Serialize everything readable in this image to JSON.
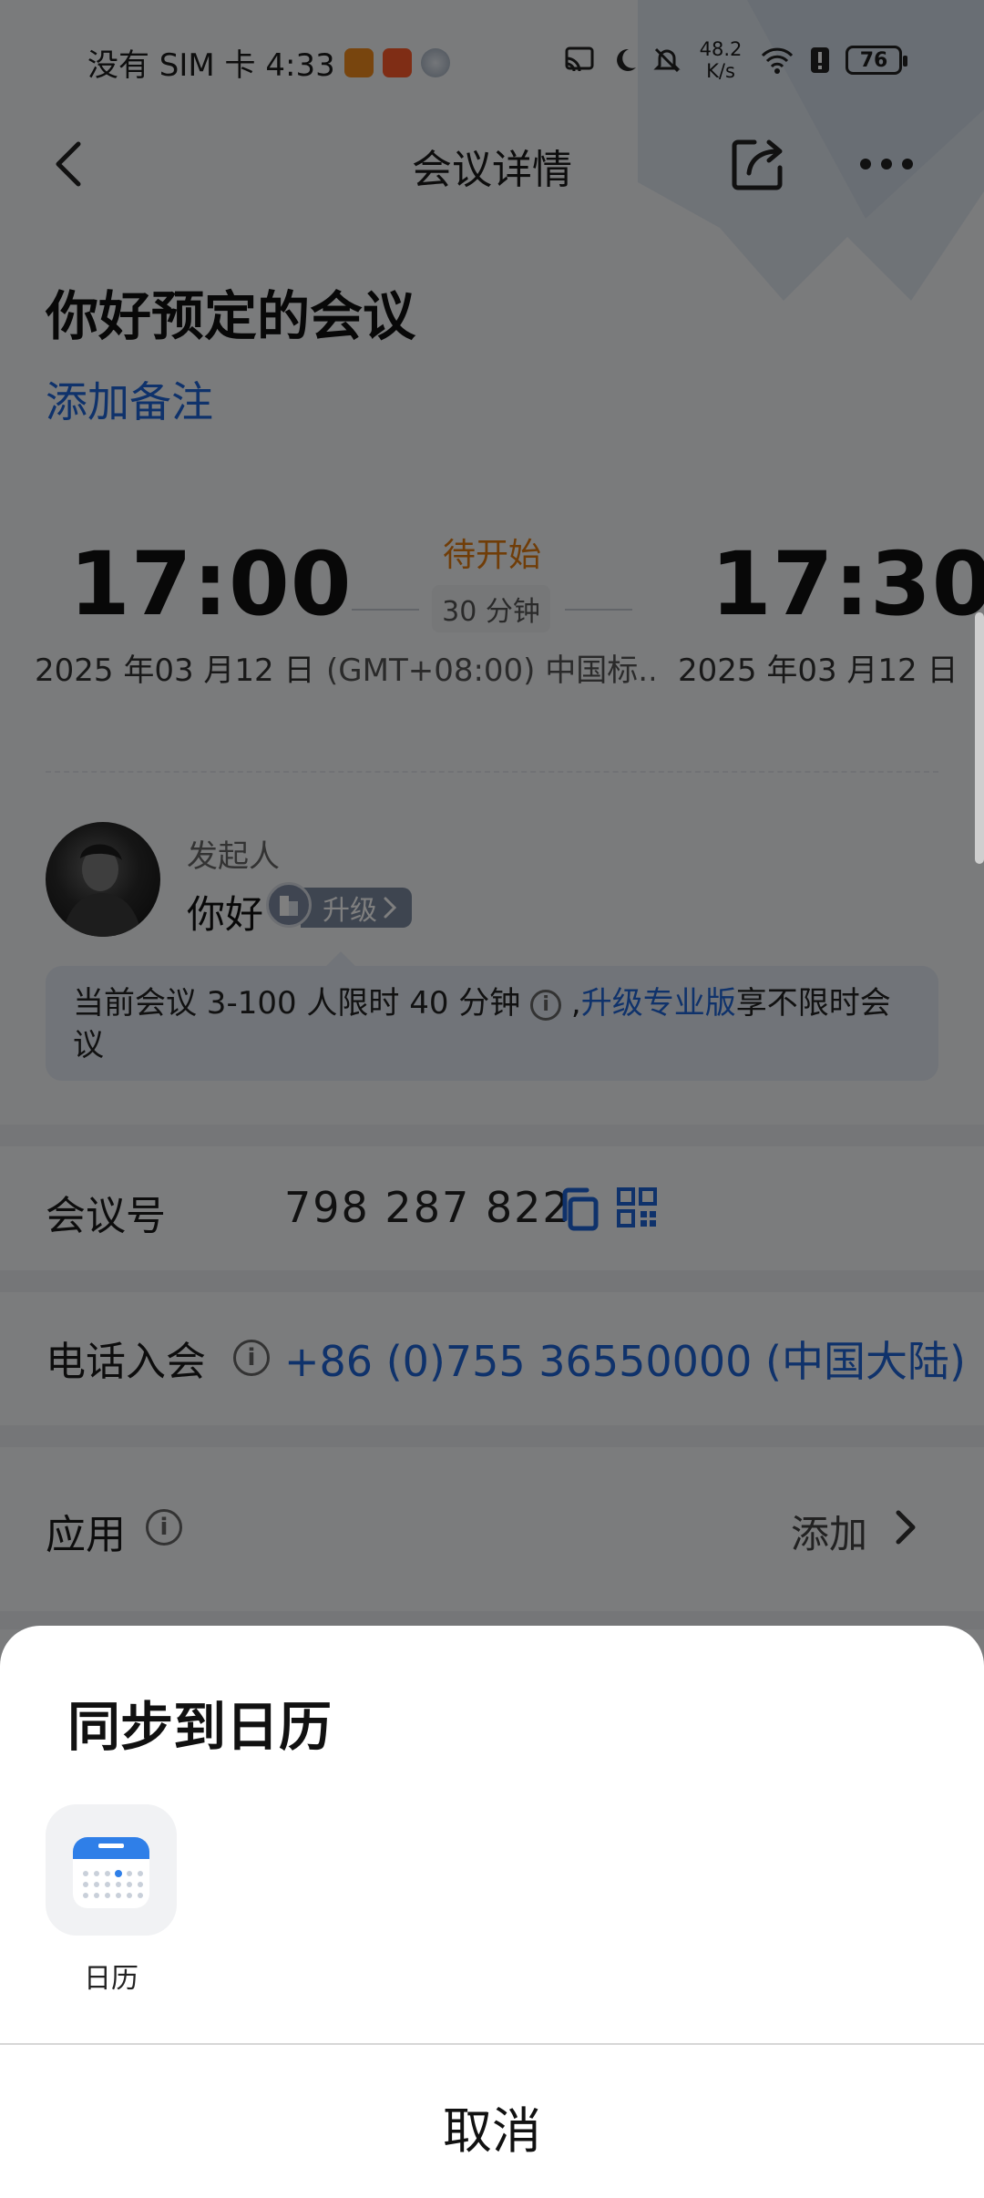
{
  "status_bar": {
    "carrier_time": "没有 SIM 卡 4:33",
    "net_speed_value": "48.2",
    "net_speed_unit": "K/s",
    "battery": "76"
  },
  "header": {
    "title": "会议详情"
  },
  "meeting": {
    "title": "你好预定的会议",
    "add_note": "添加备注",
    "start_time": "17:00",
    "end_time": "17:30",
    "start_date": "2025 年03 月12 日",
    "end_date": "2025 年03 月12 日",
    "status": "待开始",
    "duration": "30 分钟",
    "timezone": "(GMT+08:00) 中国标..."
  },
  "host": {
    "label": "发起人",
    "name": "你好",
    "upgrade_label": "升级"
  },
  "notice": {
    "text_before": "当前会议 3-100 人限时 40 分钟",
    "comma": ",",
    "link": "升级专业版",
    "text_after": "享不限时会议"
  },
  "meeting_id": {
    "label": "会议号",
    "value": "798 287 822"
  },
  "phone_join": {
    "label": "电话入会",
    "value": "+86 (0)755 36550000 (中国大陆)"
  },
  "apps": {
    "label": "应用",
    "action": "添加"
  },
  "sheet": {
    "title": "同步到日历",
    "items": [
      {
        "label": "日历",
        "icon": "calendar-app-icon"
      }
    ],
    "cancel": "取消"
  },
  "colors": {
    "accent": "#1f64d6",
    "status_pending": "#e07a10"
  }
}
